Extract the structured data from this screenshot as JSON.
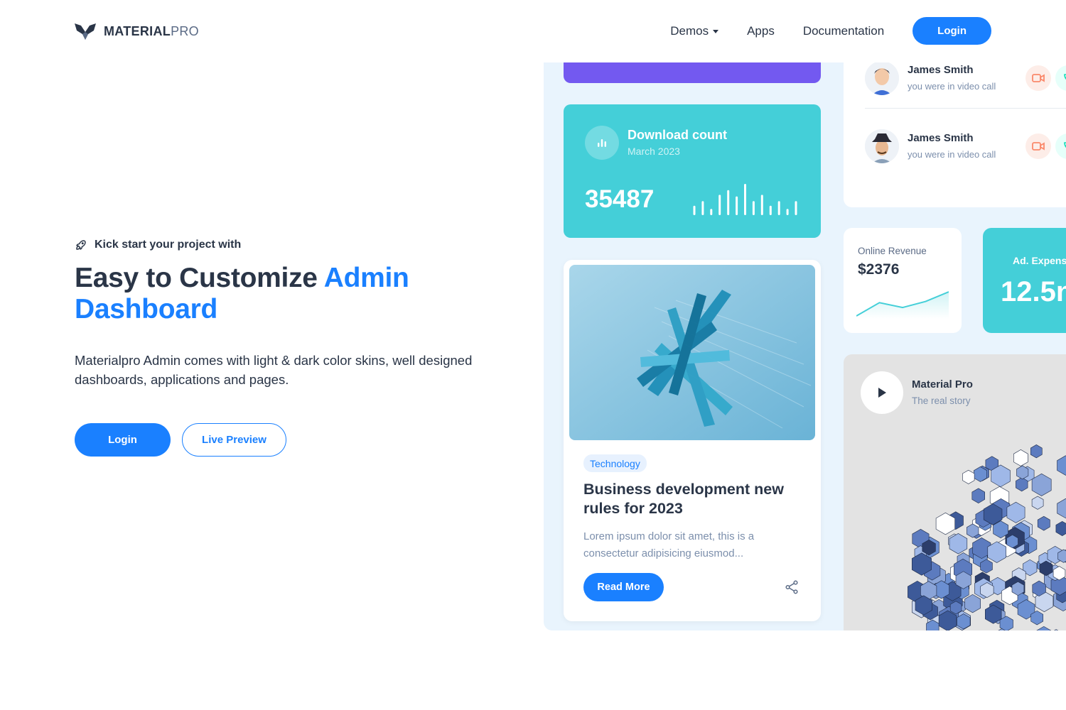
{
  "header": {
    "logo_bold": "MATERIAL",
    "logo_light": "PRO",
    "nav": [
      {
        "label": "Demos",
        "has_dropdown": true
      },
      {
        "label": "Apps"
      },
      {
        "label": "Documentation"
      }
    ],
    "login_label": "Login"
  },
  "hero": {
    "kicker": "Kick start your project with",
    "headline_part1": "Easy to Customize",
    "headline_part2": "Admin",
    "headline_part3": "Dashboard",
    "description": "Materialpro Admin comes with light & dark color skins, well designed dashboards, applications and pages.",
    "primary_button": "Login",
    "secondary_button": "Live Preview"
  },
  "showcase": {
    "download_card": {
      "title": "Download count",
      "subtitle": "March 2023",
      "count": "35487",
      "bars": [
        0.3,
        0.45,
        0.2,
        0.65,
        0.8,
        0.6,
        1.0,
        0.45,
        0.65,
        0.3,
        0.45,
        0.2,
        0.45
      ]
    },
    "blog_card": {
      "tag": "Technology",
      "title": "Business development new rules for 2023",
      "text": "Lorem ipsum dolor sit amet, this is a consectetur adipisicing eiusmod...",
      "button": "Read More"
    },
    "calls": [
      {
        "name": "James Smith",
        "status": "you were in video call"
      },
      {
        "name": "James Smith",
        "status": "you were in video call"
      }
    ],
    "revenue_card": {
      "label": "Online Revenue",
      "value": "$2376",
      "trend": [
        0.0,
        0.55,
        0.35,
        0.6,
        1.0
      ]
    },
    "expense_card": {
      "label": "Ad. Expens",
      "value": "12.5n"
    },
    "video_card": {
      "title": "Material Pro",
      "subtitle": "The real story"
    }
  },
  "colors": {
    "primary": "#1a80ff",
    "cyan": "#44cfd8",
    "purple": "#7359f0",
    "text": "#2a3547",
    "panel_bg": "#e9f4fd"
  }
}
